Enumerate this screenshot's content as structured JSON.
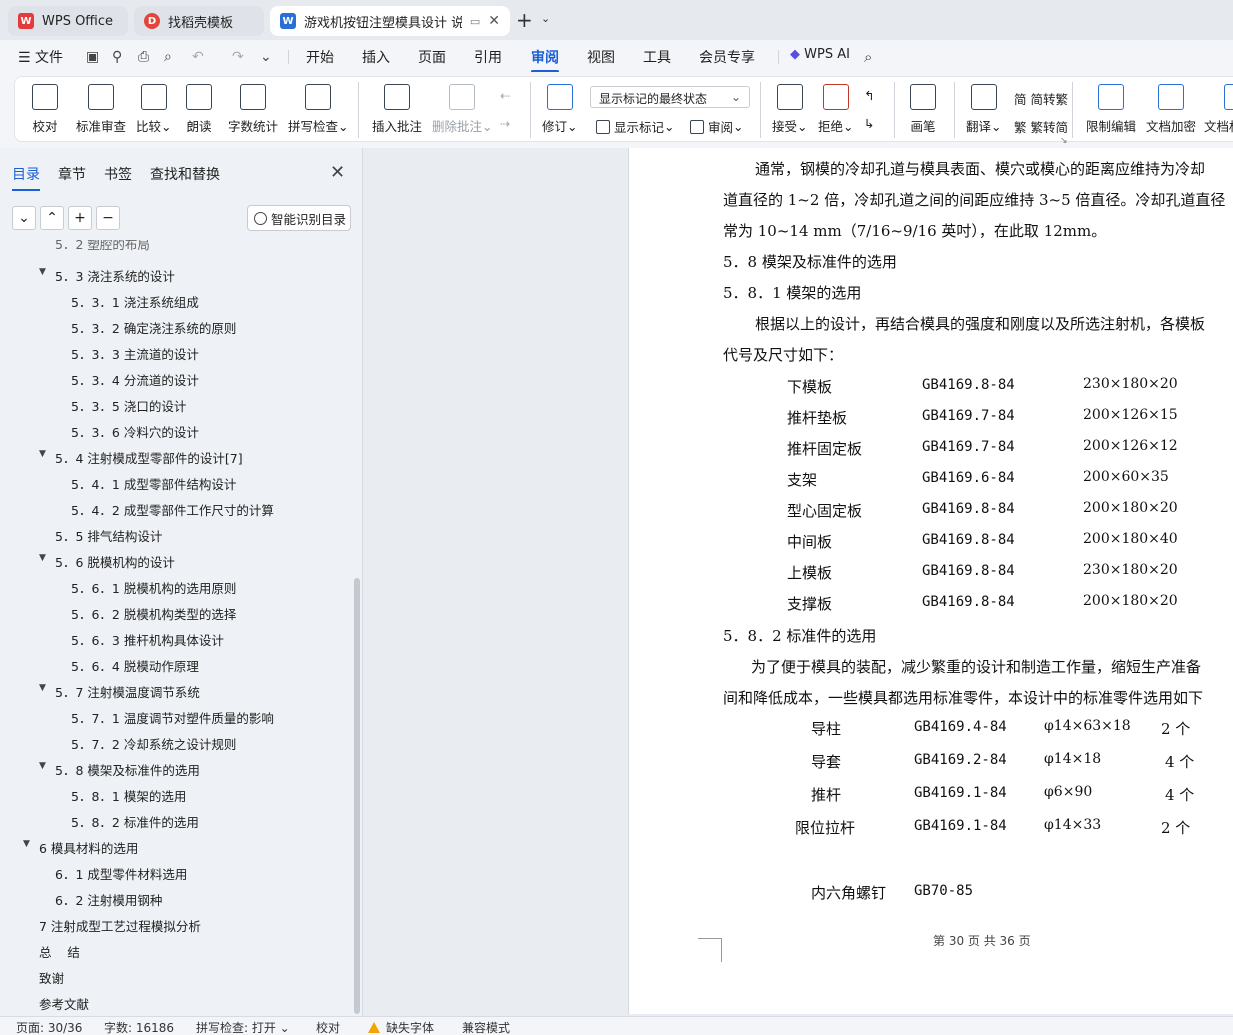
{
  "tabs": [
    {
      "label": "WPS Office",
      "icon": "wps-logo-icon",
      "color": "#e23b3b"
    },
    {
      "label": "找稻壳模板",
      "icon": "daoke-logo-icon",
      "color": "#e2453b"
    },
    {
      "label": "游戏机按钮注塑模具设计 说明",
      "icon": "writer-doc-icon",
      "color": "#2a6fd6"
    }
  ],
  "menu": {
    "file": "文件",
    "items": [
      "开始",
      "插入",
      "页面",
      "引用",
      "审阅",
      "视图",
      "工具",
      "会员专享"
    ],
    "selected": "审阅",
    "ai": "WPS AI"
  },
  "ribbon": {
    "proofread": "校对",
    "standard_review": "标准审查",
    "compare": "比较",
    "read_aloud": "朗读",
    "word_count": "字数统计",
    "spell_check": "拼写检查",
    "insert_comment": "插入批注",
    "delete_comment": "删除批注",
    "track_changes": "修订",
    "markup_dropdown": "显示标记的最终状态",
    "show_markup": "显示标记",
    "review": "审阅",
    "accept": "接受",
    "reject": "拒绝",
    "ink": "画笔",
    "translate": "翻译",
    "to_traditional": "简转繁",
    "to_simplified": "繁转简",
    "restrict_edit": "限制编辑",
    "doc_encrypt": "文档加密",
    "doc_permission": "文档权"
  },
  "nav": {
    "tabs": [
      "目录",
      "章节",
      "书签",
      "查找和替换"
    ],
    "selected": "目录",
    "smart_toc": "智能识别目录",
    "toc": [
      {
        "text": "5．2 塑腔的布局",
        "level": 2
      },
      {
        "text": "5．3 浇注系统的设计",
        "level": 2,
        "expanded": true
      },
      {
        "text": "5．3．1 浇注系统组成",
        "level": 3
      },
      {
        "text": "5．3．2 确定浇注系统的原则",
        "level": 3
      },
      {
        "text": "5．3．3 主流道的设计",
        "level": 3
      },
      {
        "text": "5．3．4 分流道的设计",
        "level": 3
      },
      {
        "text": "5．3．5 浇口的设计",
        "level": 3
      },
      {
        "text": "5．3．6 冷料穴的设计",
        "level": 3
      },
      {
        "text": "5．4 注射模成型零部件的设计[7]",
        "level": 2,
        "expanded": true
      },
      {
        "text": "5．4．1 成型零部件结构设计",
        "level": 3
      },
      {
        "text": "5．4．2 成型零部件工作尺寸的计算",
        "level": 3
      },
      {
        "text": "5．5 排气结构设计",
        "level": 2
      },
      {
        "text": "5．6 脱模机构的设计",
        "level": 2,
        "expanded": true
      },
      {
        "text": "5．6．1 脱模机构的选用原则",
        "level": 3
      },
      {
        "text": "5．6．2 脱模机构类型的选择",
        "level": 3
      },
      {
        "text": "5．6．3 推杆机构具体设计",
        "level": 3
      },
      {
        "text": "5．6．4  脱模动作原理",
        "level": 3
      },
      {
        "text": "5．7 注射模温度调节系统",
        "level": 2,
        "expanded": true
      },
      {
        "text": "5．7．1 温度调节对塑件质量的影响",
        "level": 3
      },
      {
        "text": "5．7．2  冷却系统之设计规则",
        "level": 3
      },
      {
        "text": "5．8 模架及标准件的选用",
        "level": 2,
        "expanded": true
      },
      {
        "text": "5．8．1 模架的选用",
        "level": 3
      },
      {
        "text": "5．8．2 标准件的选用",
        "level": 3
      },
      {
        "text": "6 模具材料的选用",
        "level": 1,
        "expanded": true
      },
      {
        "text": "6．1 成型零件材料选用",
        "level": 2
      },
      {
        "text": "6．2 注射模用钢种",
        "level": 2
      },
      {
        "text": "7 注射成型工艺过程模拟分析",
        "level": 1
      },
      {
        "text": "总    结",
        "level": 1
      },
      {
        "text": "致谢",
        "level": 1
      },
      {
        "text": "参考文献",
        "level": 1
      }
    ]
  },
  "doc": {
    "para1_l1": "通常，钢模的冷却孔道与模具表面、模穴或模心的距离应维持为冷却",
    "para1_l2": "道直径的 1~2 倍，冷却孔道之间的间距应维持 3~5 倍直径。冷却孔道直径",
    "para1_l3": "常为 10~14 mm（7/16~9/16 英吋），在此取 12mm。",
    "h_58": "5．8 模架及标准件的选用",
    "h_581": "5．8．1 模架的选用",
    "para2_l1": "根据以上的设计，再结合模具的强度和刚度以及所选注射机，各模板",
    "para2_l2": "代号及尺寸如下：",
    "plates": [
      {
        "name": "下模板",
        "code": "GB4169.8-84",
        "size": "230×180×20"
      },
      {
        "name": "推杆垫板",
        "code": "GB4169.7-84",
        "size": "200×126×15"
      },
      {
        "name": "推杆固定板",
        "code": "GB4169.7-84",
        "size": "200×126×12"
      },
      {
        "name": "支架",
        "code": "GB4169.6-84",
        "size": "200×60×35"
      },
      {
        "name": "型心固定板",
        "code": "GB4169.8-84",
        "size": "200×180×20"
      },
      {
        "name": "中间板",
        "code": "GB4169.8-84",
        "size": "200×180×40"
      },
      {
        "name": "上模板",
        "code": "GB4169.8-84",
        "size": "230×180×20"
      },
      {
        "name": "支撑板",
        "code": "GB4169.8-84",
        "size": "200×180×20"
      }
    ],
    "h_582": "5．8．2 标准件的选用",
    "para3_l1": "为了便于模具的装配，减少繁重的设计和制造工作量，缩短生产准备",
    "para3_l2": "间和降低成本，一些模具都选用标准零件，本设计中的标准零件选用如下",
    "parts": [
      {
        "name": "导柱",
        "code": "GB4169.4-84",
        "size": "φ14×63×18",
        "qty": "2 个"
      },
      {
        "name": "导套",
        "code": "GB4169.2-84",
        "size": "φ14×18",
        "qty": "4 个"
      },
      {
        "name": "推杆",
        "code": "GB4169.1-84",
        "size": "φ6×90",
        "qty": "4 个"
      },
      {
        "name": "限位拉杆",
        "code": "GB4169.1-84",
        "size": "φ14×33",
        "qty": "2 个"
      }
    ],
    "screw_name": "内六角螺钉",
    "screw_code": "GB70-85",
    "footer": "第 30 页 共 36 页"
  },
  "status": {
    "page": "页面: 30/36",
    "words": "字数: 16186",
    "spell": "拼写检查: 打开",
    "proof": "校对",
    "missing_font": "缺失字体",
    "compat": "兼容模式"
  },
  "colors": {
    "accent": "#1c5fd6",
    "warning": "#f2a500"
  }
}
